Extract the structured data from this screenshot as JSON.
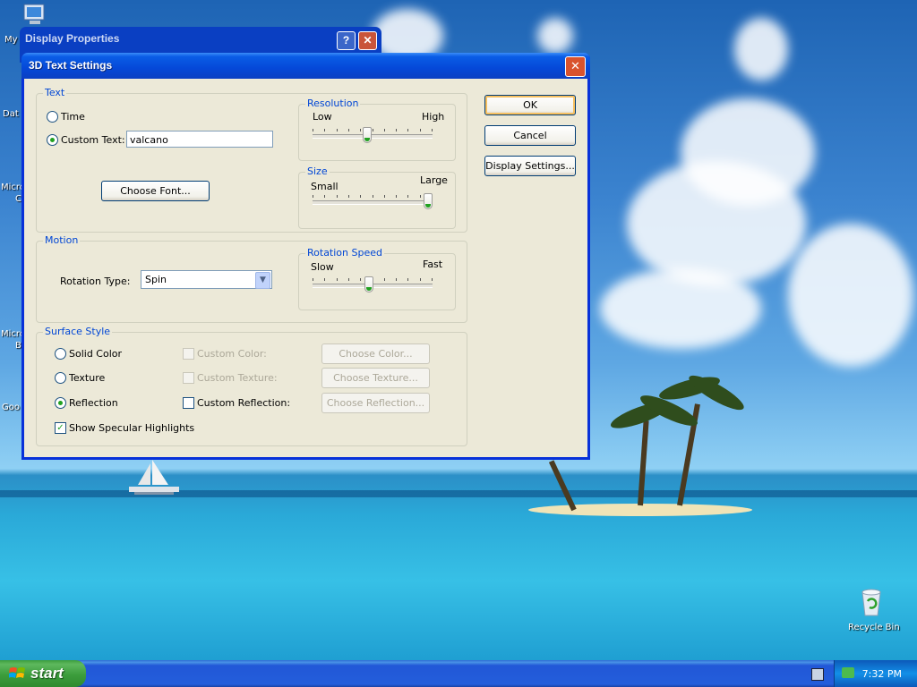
{
  "desktop": {
    "icons": [
      {
        "label": "My"
      },
      {
        "label": "Dat"
      },
      {
        "label": "Micro"
      },
      {
        "label": "C"
      },
      {
        "label": "Micro"
      },
      {
        "label": "B"
      },
      {
        "label": "Goo"
      }
    ],
    "recycle_bin": {
      "label": "Recycle Bin",
      "icon": "recycle-bin-icon"
    }
  },
  "back_window": {
    "title": "Display Properties",
    "help_label": "?",
    "close_label": "✕"
  },
  "dialog": {
    "title": "3D Text Settings",
    "close_label": "✕",
    "text_group": {
      "label": "Text",
      "time_label": "Time",
      "custom_text_label": "Custom Text:",
      "custom_text_value": "valcano",
      "selected": "custom_text",
      "choose_font_label": "Choose Font..."
    },
    "resolution": {
      "label": "Resolution",
      "min_label": "Low",
      "max_label": "High",
      "value_fraction": 0.45
    },
    "size": {
      "label": "Size",
      "min_label": "Small",
      "max_label": "Large",
      "value_fraction": 1.0
    },
    "motion": {
      "label": "Motion",
      "rotation_type_label": "Rotation Type:",
      "rotation_type_value": "Spin"
    },
    "rotation_speed": {
      "label": "Rotation Speed",
      "min_label": "Slow",
      "max_label": "Fast",
      "value_fraction": 0.47
    },
    "surface": {
      "label": "Surface Style",
      "solid_color_label": "Solid Color",
      "texture_label": "Texture",
      "reflection_label": "Reflection",
      "selected": "reflection",
      "custom_color_label": "Custom Color:",
      "custom_texture_label": "Custom Texture:",
      "custom_reflection_label": "Custom Reflection:",
      "choose_color_label": "Choose Color...",
      "choose_texture_label": "Choose Texture...",
      "choose_reflection_label": "Choose Reflection...",
      "specular_label": "Show Specular Highlights",
      "specular_checked": true
    },
    "buttons": {
      "ok_label": "OK",
      "cancel_label": "Cancel",
      "display_settings_label": "Display Settings..."
    }
  },
  "taskbar": {
    "start_label": "start",
    "clock": "7:32 PM"
  },
  "colors": {
    "title_bar": "#0a5de6",
    "group_label": "#0046d5",
    "radio_dot": "#21a121",
    "taskbar": "#245edb",
    "start_button": "#3c9d3c"
  }
}
